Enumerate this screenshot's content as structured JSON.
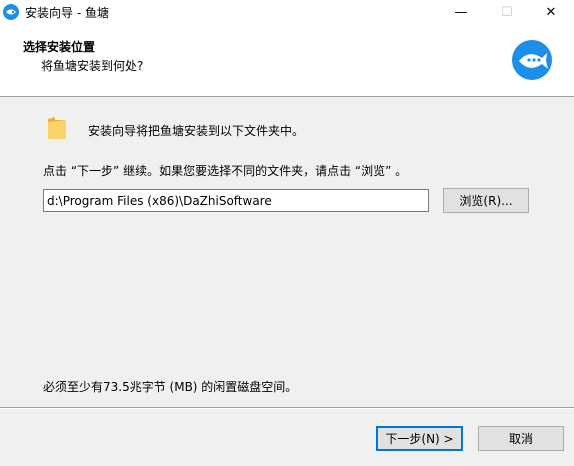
{
  "window": {
    "title": "安装向导 - 鱼塘",
    "minimize_glyph": "—",
    "maximize_glyph": "☐",
    "close_glyph": "✕"
  },
  "header": {
    "title": "选择安装位置",
    "subtitle": "将鱼塘安装到何处?"
  },
  "body": {
    "intro": "安装向导将把鱼塘安装到以下文件夹中。",
    "instruction": "点击 “下一步” 继续。如果您要选择不同的文件夹，请点击 “浏览” 。",
    "path_value": "d:\\Program Files (x86)\\DaZhiSoftware",
    "browse_label": "浏览(R)...",
    "space_required": "必须至少有73.5兆字节 (MB) 的闲置磁盘空间。"
  },
  "footer": {
    "next_label": "下一步(N) >",
    "cancel_label": "取消"
  },
  "icons": {
    "app": "fish-logo-icon",
    "folder": "folder-icon"
  },
  "colors": {
    "accent": "#0078d7",
    "logo_blue": "#1e8fe8",
    "folder_yellow": "#f4c44a"
  }
}
